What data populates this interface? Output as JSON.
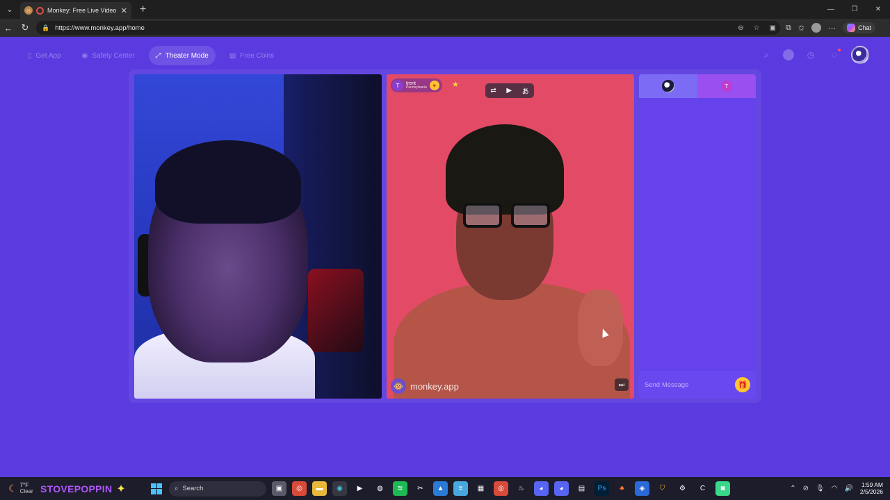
{
  "browser": {
    "tab_title": "Monkey: Free Live Video Chat",
    "url": "https://www.monkey.app/home",
    "copilot_label": "Chat"
  },
  "site": {
    "nav": [
      {
        "label": "Get App",
        "icon": "phone-icon"
      },
      {
        "label": "Safety Center",
        "icon": "shield-icon"
      },
      {
        "label": "Theater Mode",
        "icon": "expand-icon",
        "active": true
      },
      {
        "label": "Free Coins",
        "icon": "coins-icon"
      }
    ]
  },
  "peer": {
    "avatar_letter": "T",
    "name": "trent",
    "location": "Pennsylvania"
  },
  "watermark": "monkey.app",
  "chat": {
    "tab2_letter": "T",
    "placeholder": "Send Message"
  },
  "taskbar": {
    "temperature": "7°F",
    "condition": "Clear",
    "streamer": "STOVEPOPPIN",
    "search": "Search",
    "time": "1:59 AM",
    "date": "2/5/2026"
  },
  "colors": {
    "page_bg": "#5b3be0",
    "chat_bg": "#6542ec",
    "peer_video_bg": "#e24a66",
    "gift": "#ffc82c"
  }
}
